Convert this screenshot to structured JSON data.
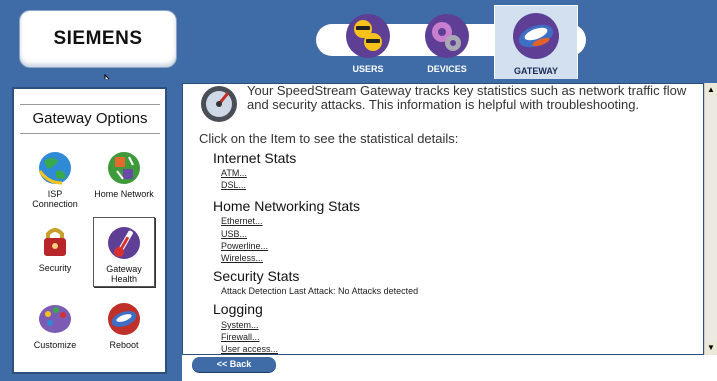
{
  "brand": "SIEMENS",
  "nav": {
    "users_label": "USERS",
    "devices_label": "DEVICES",
    "gateway_label": "GATEWAY"
  },
  "sidebar": {
    "title": "Gateway Options",
    "items": [
      {
        "label": "ISP Connection"
      },
      {
        "label": "Home Network"
      },
      {
        "label": "Security"
      },
      {
        "label": "Gateway Health"
      },
      {
        "label": "Customize"
      },
      {
        "label": "Reboot"
      }
    ]
  },
  "main": {
    "intro": "Your SpeedStream Gateway tracks key statistics such as network traffic flow and security attacks. This information is helpful with troubleshooting.",
    "click_text": "Click on the Item to see the statistical details:",
    "sections": [
      {
        "title": "Internet Stats",
        "links": [
          "ATM...",
          "DSL..."
        ]
      },
      {
        "title": "Home Networking Stats",
        "links": [
          "Ethernet...",
          "USB...",
          "Powerline...",
          "Wireless..."
        ]
      },
      {
        "title": "Security Stats",
        "text": "Attack Detection Last Attack: No Attacks detected"
      },
      {
        "title": "Logging",
        "links": [
          "System...",
          "Firewall...",
          "User access..."
        ]
      }
    ]
  },
  "footer": {
    "back_label": "<< Back"
  },
  "colors": {
    "frame": "#3f6ca6",
    "selected_tab": "#d3e0ef"
  }
}
